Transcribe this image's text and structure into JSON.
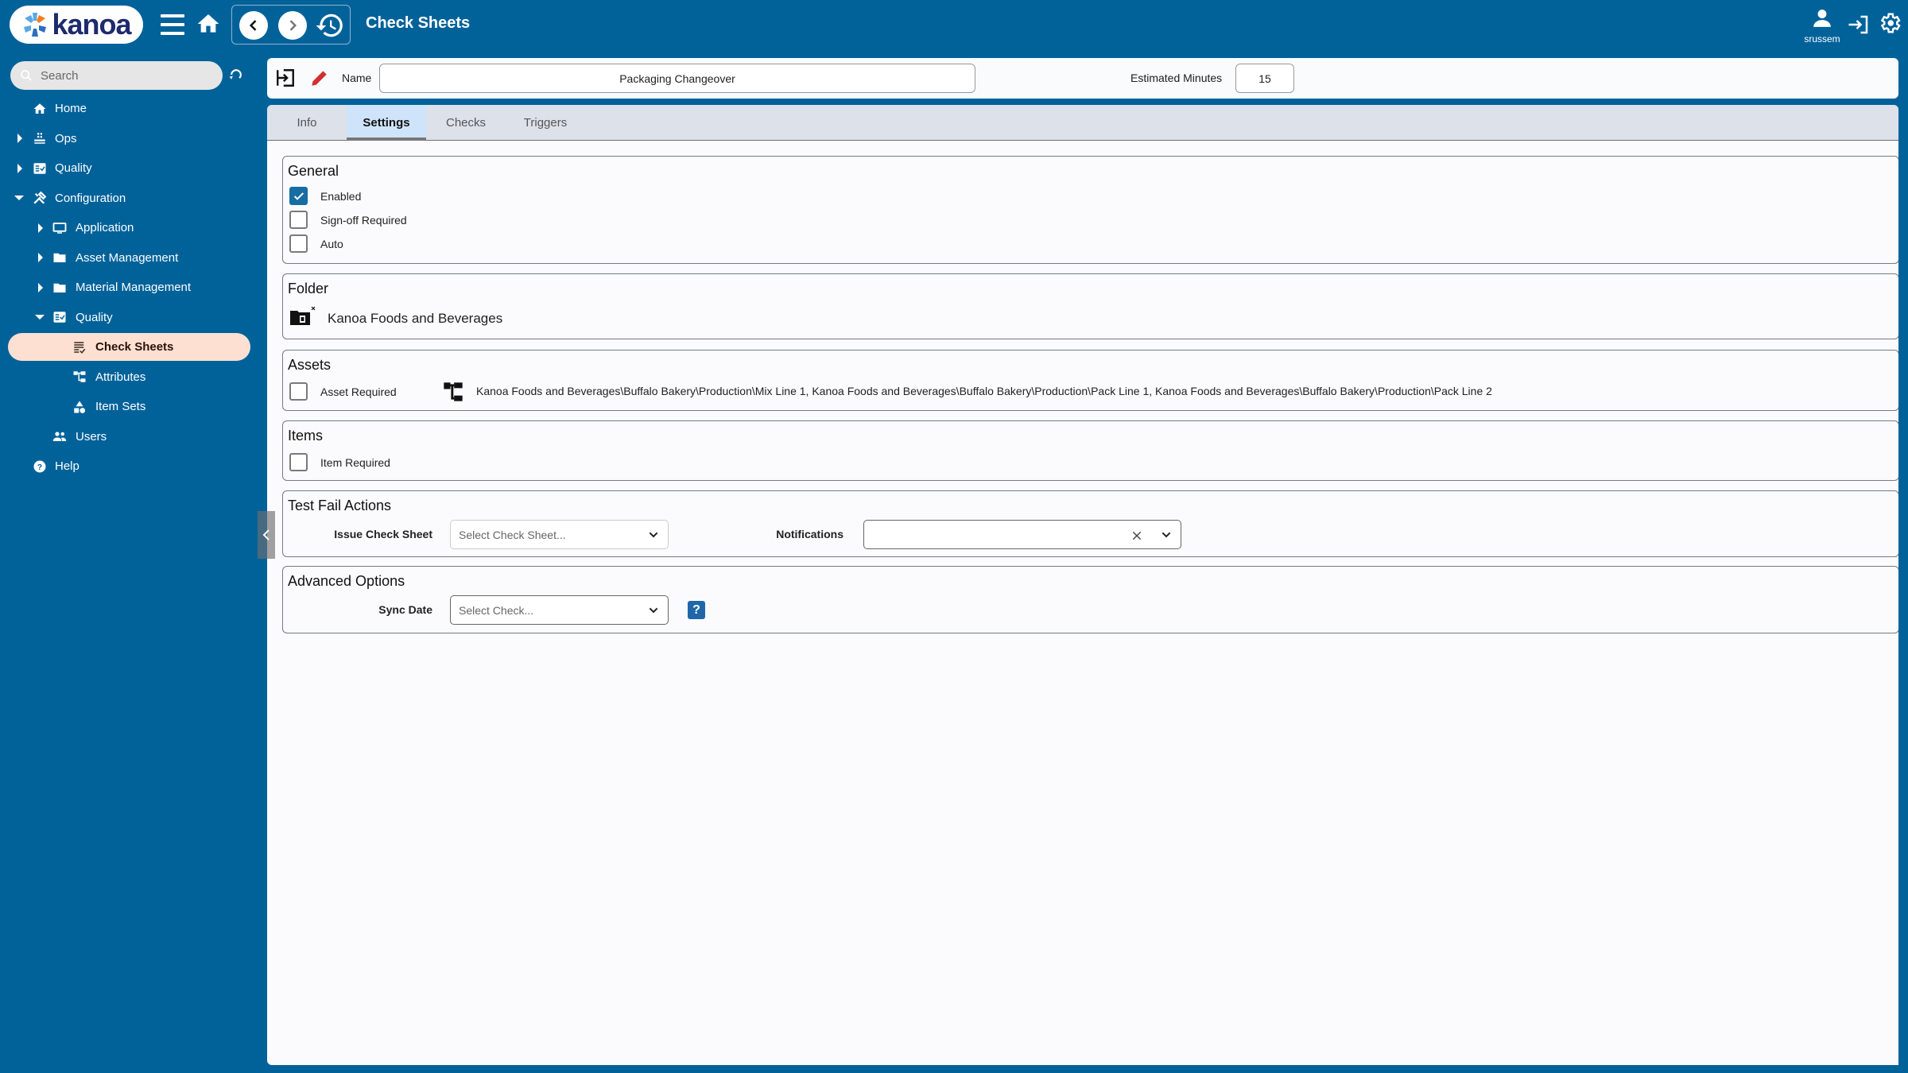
{
  "header": {
    "logo_text": "kanoa",
    "title": "Check Sheets",
    "username": "srussem"
  },
  "sidebar": {
    "search_placeholder": "Search",
    "items": [
      {
        "label": "Home",
        "icon": "home-icon"
      },
      {
        "label": "Ops",
        "icon": "conveyor-icon"
      },
      {
        "label": "Quality",
        "icon": "checklist-icon"
      },
      {
        "label": "Configuration",
        "icon": "tools-icon"
      },
      {
        "label": "Application",
        "icon": "monitor-icon"
      },
      {
        "label": "Asset Management",
        "icon": "folder-icon"
      },
      {
        "label": "Material Management",
        "icon": "folder-icon"
      },
      {
        "label": "Quality",
        "icon": "checklist-icon"
      },
      {
        "label": "Check Sheets",
        "icon": "check-list-icon",
        "active": true
      },
      {
        "label": "Attributes",
        "icon": "hierarchy-icon"
      },
      {
        "label": "Item Sets",
        "icon": "shapes-icon"
      },
      {
        "label": "Users",
        "icon": "users-icon"
      },
      {
        "label": "Help",
        "icon": "help-icon"
      }
    ]
  },
  "namebar": {
    "name_label": "Name",
    "name_value": "Packaging Changeover",
    "est_label": "Estimated Minutes",
    "est_value": "15"
  },
  "tabs": [
    {
      "label": "Info"
    },
    {
      "label": "Settings",
      "active": true
    },
    {
      "label": "Checks"
    },
    {
      "label": "Triggers"
    }
  ],
  "general": {
    "title": "General",
    "options": [
      {
        "label": "Enabled",
        "checked": true
      },
      {
        "label": "Sign-off Required",
        "checked": false
      },
      {
        "label": "Auto",
        "checked": false
      }
    ]
  },
  "folder": {
    "title": "Folder",
    "value": "Kanoa Foods and Beverages"
  },
  "assets": {
    "title": "Assets",
    "required_label": "Asset Required",
    "required_checked": false,
    "value": "Kanoa Foods and Beverages\\Buffalo Bakery\\Production\\Mix Line 1, Kanoa Foods and Beverages\\Buffalo Bakery\\Production\\Pack Line 1, Kanoa Foods and Beverages\\Buffalo Bakery\\Production\\Pack Line 2"
  },
  "items": {
    "title": "Items",
    "required_label": "Item Required",
    "required_checked": false
  },
  "test_fail": {
    "title": "Test Fail Actions",
    "issue_label": "Issue Check Sheet",
    "issue_placeholder": "Select Check Sheet...",
    "notifications_label": "Notifications",
    "notifications_value": ""
  },
  "advanced": {
    "title": "Advanced Options",
    "sync_label": "Sync Date",
    "sync_placeholder": "Select Check...",
    "help_label": "?"
  },
  "colors": {
    "brand": "#01629a",
    "active_nav": "#fde0d2",
    "active_tab": "#cfe4fa",
    "checkbox": "#156da3",
    "edit_icon": "#d32f2f"
  }
}
